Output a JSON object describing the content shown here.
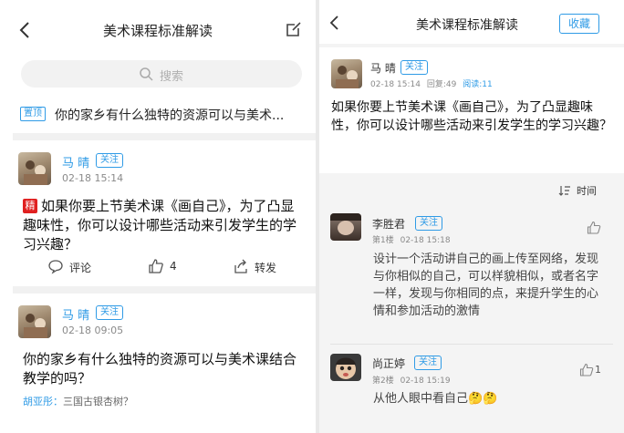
{
  "colors": {
    "accent": "#2f9be6",
    "badge_red": "#e02020",
    "separator": "#f1f1f1"
  },
  "left": {
    "title": "美术课程标准解读",
    "search_placeholder": "搜索",
    "pinned": {
      "badge": "置顶",
      "text": "你的家乡有什么独特的资源可以与美术..."
    },
    "posts": [
      {
        "author": "马 晴",
        "follow": "关注",
        "time": "02-18 15:14",
        "badge": "精",
        "text": "如果你要上节美术课《画自己》，为了凸显趣味性，你可以设计哪些活动来引发学生的学习兴趣？",
        "actions": {
          "comment": "评论",
          "likes": "4",
          "share": "转发"
        }
      },
      {
        "author": "马 晴",
        "follow": "关注",
        "time": "02-18 09:05",
        "text": "你的家乡有什么独特的资源可以与美术课结合教学的吗？",
        "reply_author": "胡亚彤：",
        "reply_text": "三国古银杏树？"
      }
    ]
  },
  "right": {
    "title": "美术课程标准解读",
    "fav_label": "收藏",
    "op": {
      "author": "马 晴",
      "follow": "关注",
      "time": "02-18 15:14",
      "replies": "回复:49",
      "reads": "阅读:11",
      "text": "如果你要上节美术课《画自己》，为了凸显趣味性，你可以设计哪些活动来引发学生的学习兴趣？"
    },
    "sort_label": "时间",
    "comments": [
      {
        "author": "李胜君",
        "follow": "关注",
        "floor": "第1楼",
        "time": "02-18 15:18",
        "likes": "",
        "text": "设计一个活动讲自己的画上传至网络，发现与你相似的自己，可以样貌相似，或者名字一样，发现与你相同的点，来提升学生的心情和参加活动的激情"
      },
      {
        "author": "尚正婷",
        "follow": "关注",
        "floor": "第2楼",
        "time": "02-18 15:19",
        "likes": "1",
        "text": "从他人眼中看自己🤔🤔"
      }
    ]
  }
}
